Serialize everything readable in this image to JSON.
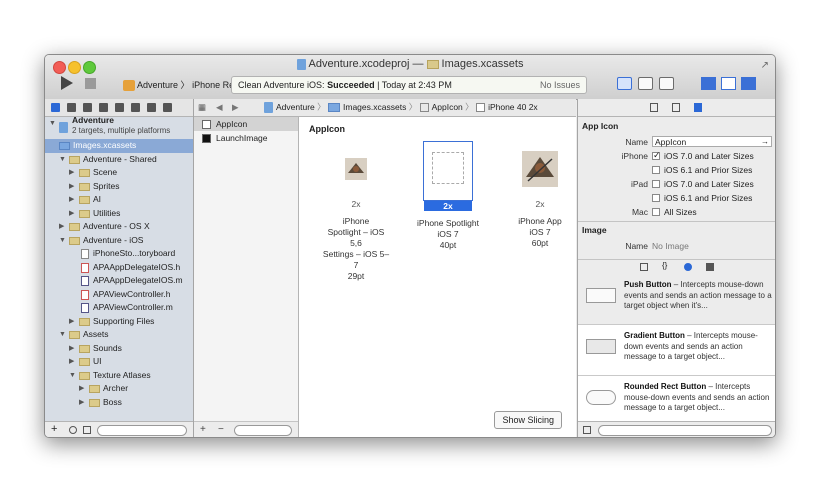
{
  "window": {
    "title_file": "Adventure.xcodeproj",
    "title_sep": "—",
    "title_folder": "Images.xcassets"
  },
  "toolbar": {
    "scheme": "Adventure",
    "scheme_arrow": "〉",
    "destination": "iPhone Ret...",
    "status_prefix": "Clean Adventure iOS: ",
    "status_result": "Succeeded",
    "status_time": " | Today at 2:43 PM",
    "issues": "No Issues"
  },
  "navigator": {
    "project_name": "Adventure",
    "project_sub": "2 targets, multiple platforms",
    "items": [
      {
        "label": "Images.xcassets"
      },
      {
        "label": "Adventure - Shared"
      },
      {
        "label": "Scene"
      },
      {
        "label": "Sprites"
      },
      {
        "label": "AI"
      },
      {
        "label": "Utilities"
      },
      {
        "label": "Adventure - OS X"
      },
      {
        "label": "Adventure - iOS"
      },
      {
        "label": "iPhoneSto...toryboard"
      },
      {
        "label": "APAAppDelegateIOS.h"
      },
      {
        "label": "APAAppDelegateIOS.m"
      },
      {
        "label": "APAViewController.h"
      },
      {
        "label": "APAViewController.m"
      },
      {
        "label": "Supporting Files"
      },
      {
        "label": "Assets"
      },
      {
        "label": "Sounds"
      },
      {
        "label": "UI"
      },
      {
        "label": "Texture Atlases"
      },
      {
        "label": "Archer"
      },
      {
        "label": "Boss"
      }
    ],
    "add": "+"
  },
  "assets": {
    "items": [
      {
        "label": "AppIcon"
      },
      {
        "label": "LaunchImage"
      }
    ],
    "add": "+",
    "remove": "−"
  },
  "jumpbar": {
    "crumb1": "Adventure",
    "crumb2": "Images.xcassets",
    "crumb3": "AppIcon",
    "crumb4": "iPhone 40 2x",
    "sep": "〉"
  },
  "canvas": {
    "title": "AppIcon",
    "slots": [
      {
        "scale": "2x",
        "desc1": "iPhone",
        "desc2": "Spotlight – iOS 5,6",
        "desc3": "Settings – iOS 5–7",
        "desc4": "29pt"
      },
      {
        "scale": "2x",
        "desc1": "iPhone Spotlight",
        "desc2": "iOS 7",
        "desc3": "40pt",
        "desc4": ""
      },
      {
        "scale": "2x",
        "desc1": "iPhone App",
        "desc2": "iOS 7",
        "desc3": "60pt",
        "desc4": ""
      }
    ],
    "show_slicing": "Show Slicing"
  },
  "inspector": {
    "section1": "App Icon",
    "name_label": "Name",
    "name_value": "AppIcon",
    "iphone_label": "iPhone",
    "ipad_label": "iPad",
    "mac_label": "Mac",
    "opt_ios7": "iOS 7.0 and Later Sizes",
    "opt_ios6": "iOS 6.1 and Prior Sizes",
    "opt_ipad7": "iOS 7.0 and Later Sizes",
    "opt_ipad6": "iOS 6.1 and Prior Sizes",
    "opt_mac": "All Sizes",
    "section2": "Image",
    "image_name_label": "Name",
    "image_name_value": "No Image",
    "lib": [
      {
        "title": "Push Button",
        "text": " – Intercepts mouse-down events and sends an action message to a target object when it's..."
      },
      {
        "title": "Gradient Button",
        "text": " – Intercepts mouse-down events and sends an action message to a target object..."
      },
      {
        "title": "Rounded Rect Button",
        "text": " – Intercepts mouse-down events and sends an action message to a target object..."
      }
    ]
  }
}
